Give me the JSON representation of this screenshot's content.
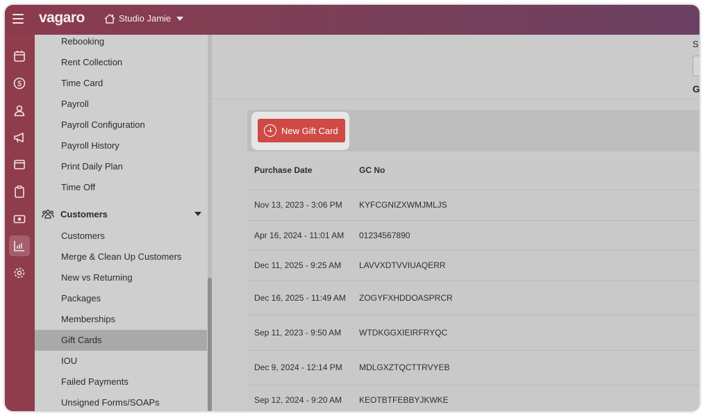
{
  "header": {
    "logo": "vagaro",
    "studio_name": "Studio Jamie"
  },
  "rail": {
    "icons": [
      "calendar-icon",
      "dollar-icon",
      "user-icon",
      "megaphone-icon",
      "browser-icon",
      "clipboard-icon",
      "cash-icon",
      "reports-icon",
      "settings-icon"
    ],
    "active": "reports-icon"
  },
  "nav": {
    "items_top": [
      "Rebooking",
      "Rent Collection",
      "Time Card",
      "Payroll",
      "Payroll Configuration",
      "Payroll History",
      "Print Daily Plan",
      "Time Off"
    ],
    "section": "Customers",
    "items_customers": [
      "Customers",
      "Merge & Clean Up Customers",
      "New vs Returning",
      "Packages",
      "Memberships",
      "Gift Cards",
      "IOU",
      "Failed Payments",
      "Unsigned Forms/SOAPs"
    ],
    "selected": "Gift Cards"
  },
  "main": {
    "header_partial_s": "S",
    "header_partial_g": "G",
    "new_gift_card_label": "New Gift Card",
    "columns": [
      "Purchase Date",
      "GC No"
    ],
    "rows": [
      [
        "Nov 13, 2023 - 3:06 PM",
        "KYFCGNIZXWMJMLJS"
      ],
      [
        "Apr 16, 2024 - 11:01 AM",
        "01234567890"
      ],
      [
        "Dec 11, 2025 - 9:25 AM",
        "LAVVXDTVVIUAQERR"
      ],
      [
        "Dec 16, 2025 - 11:49 AM",
        "ZOGYFXHDDOASPRCR"
      ],
      [
        "Sep 11, 2023 - 9:50 AM",
        "WTDKGGXIEIRFRYQC"
      ],
      [
        "Dec 9, 2024 - 12:14 PM",
        "MDLGXZTQCTTRVYEB"
      ],
      [
        "Sep 12, 2024 - 9:20 AM",
        "KEOTBTFEBBYJKWKE"
      ]
    ]
  },
  "colors": {
    "brand_header": "#8c3b4d",
    "rail": "#8f3c4c",
    "primary_button": "#cf4a44"
  }
}
